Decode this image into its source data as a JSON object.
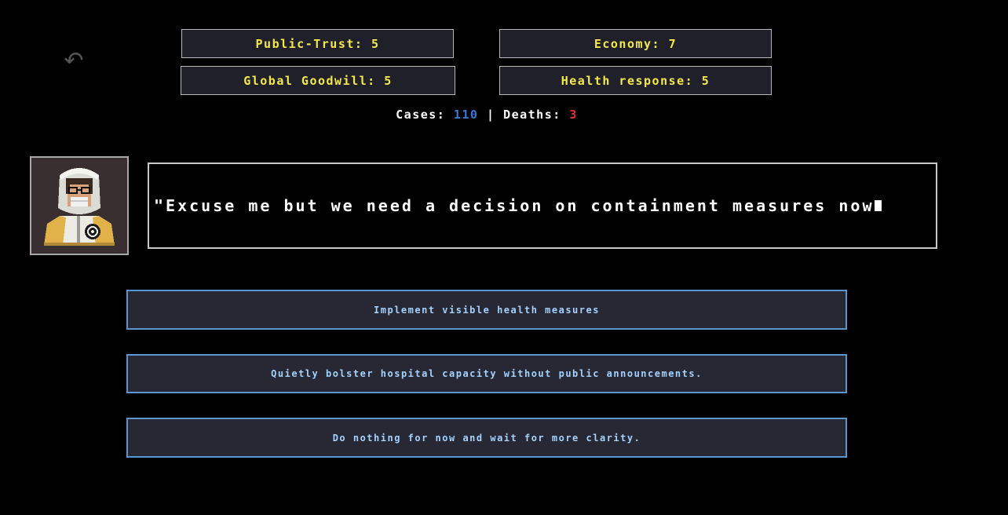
{
  "toolbar": {
    "undo_icon": "↶"
  },
  "stats": {
    "public_trust": "Public-Trust: 5",
    "economy": "Economy: 7",
    "global_goodwill": "Global Goodwill: 5",
    "health_response": "Health response: 5"
  },
  "counters": {
    "cases_label": "Cases:",
    "cases_value": "110",
    "separator": "|",
    "deaths_label": "Deaths:",
    "deaths_value": "3"
  },
  "speaker": {
    "portrait_icon": "hazmat-scientist-portrait"
  },
  "dialog": {
    "text": "\"Excuse me but we need a decision on containment measures now"
  },
  "choices": [
    {
      "label": "Implement visible health measures"
    },
    {
      "label": "Quietly bolster hospital capacity without public announcements."
    },
    {
      "label": "Do nothing for now and wait for more clarity."
    }
  ],
  "colors": {
    "stat_text": "#f4e84a",
    "cases": "#3a78d8",
    "deaths": "#e03030",
    "choice_border": "#5b95cf",
    "choice_text": "#a4d2ff"
  }
}
